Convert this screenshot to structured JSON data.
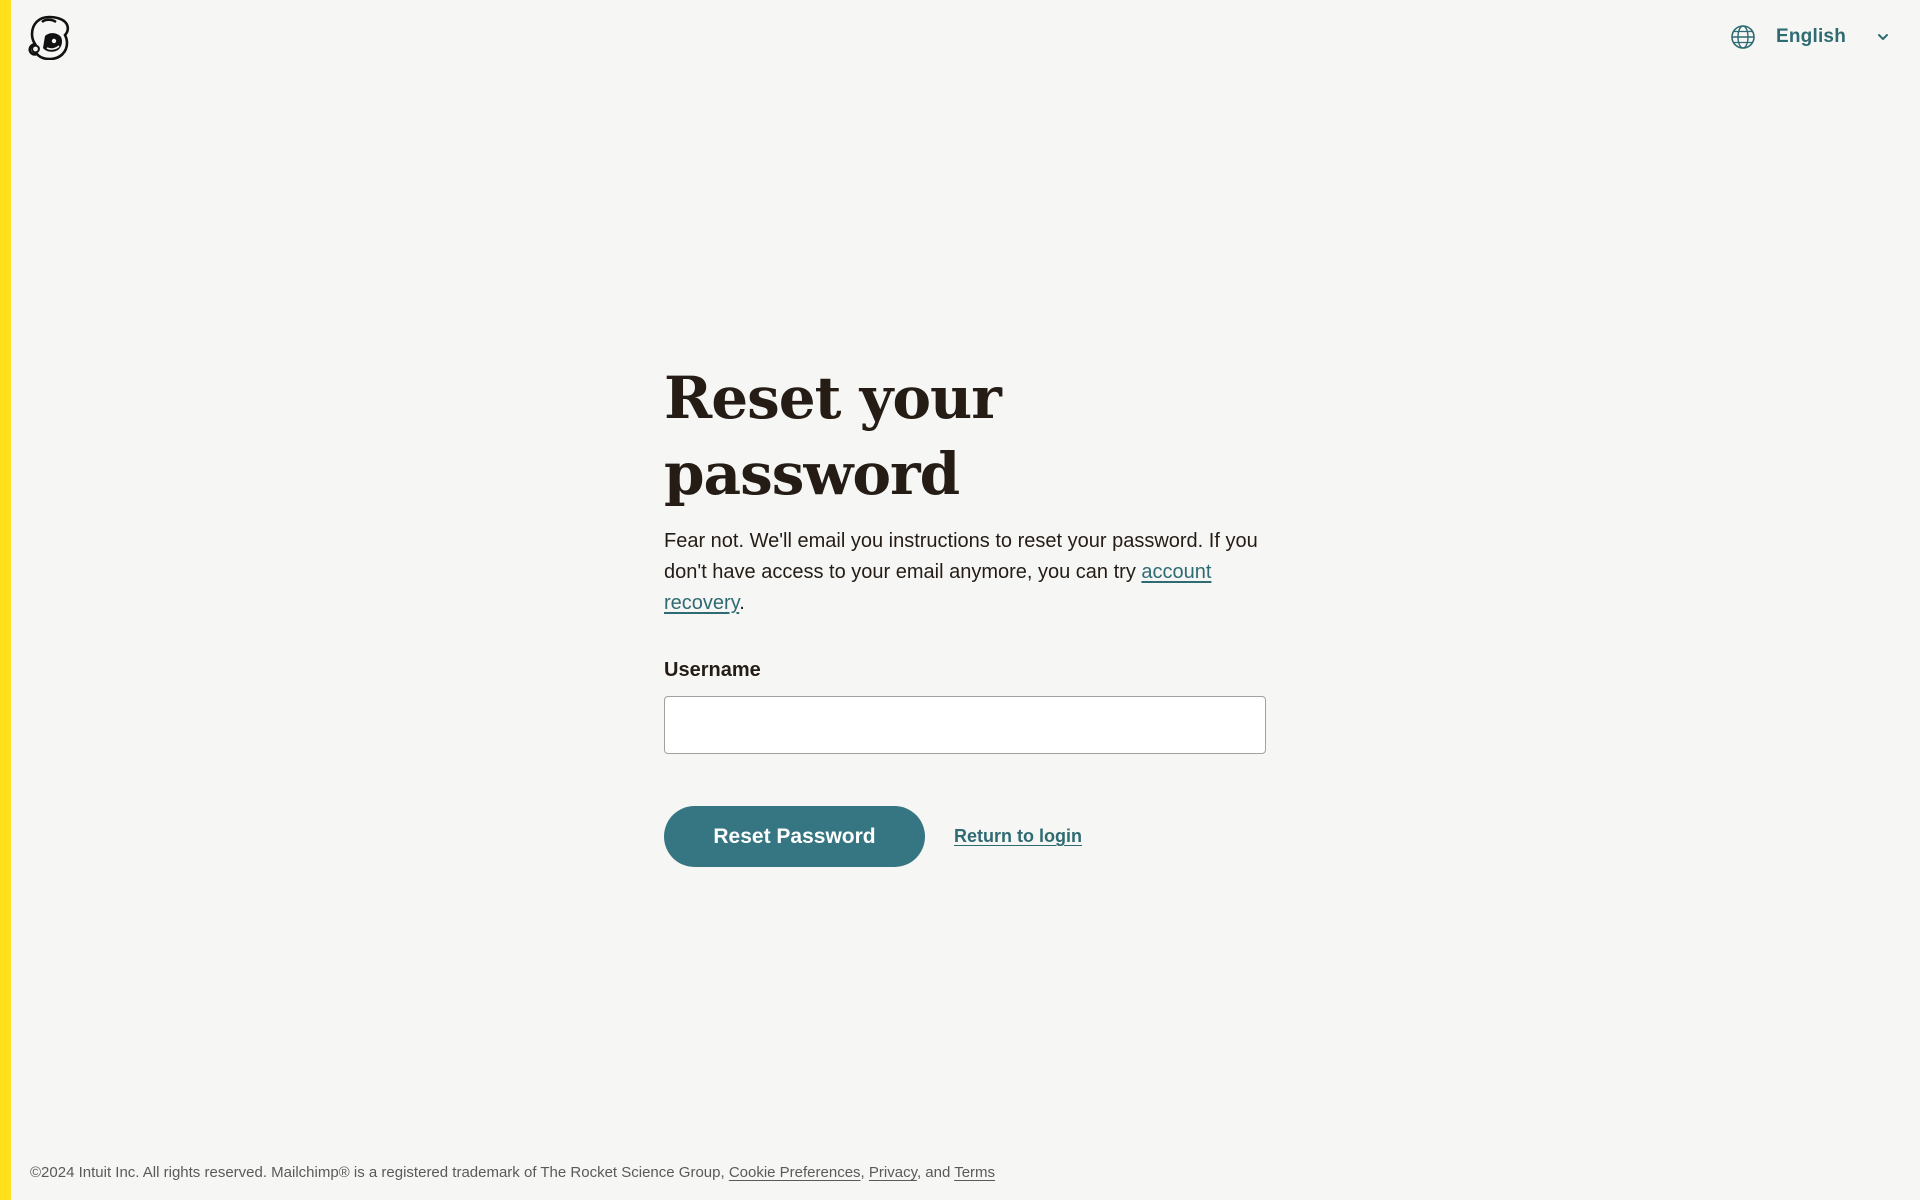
{
  "header": {
    "logo_icon": "mailchimp-freddie-logo",
    "language": {
      "icon": "globe-icon",
      "selected": "English",
      "chevron_icon": "chevron-down-icon"
    }
  },
  "main": {
    "title": "Reset your password",
    "description_text": "Fear not. We'll email you instructions to reset your password. If you don't have access to your email anymore, you can try ",
    "recovery_link": "account recovery",
    "description_end": ".",
    "username_label": "Username",
    "username_value": "",
    "username_placeholder": "",
    "reset_button": "Reset Password",
    "return_link": "Return to login"
  },
  "footer": {
    "text": "©2024 Intuit Inc. All rights reserved. Mailchimp® is a registered trademark of The Rocket Science Group, ",
    "cookie_link": "Cookie Preferences",
    "sep1": ", ",
    "privacy_link": "Privacy",
    "sep2": ", and ",
    "terms_link": "Terms"
  },
  "colors": {
    "accent_bar": "#ffe01b",
    "primary": "#357682",
    "link": "#2f6b73",
    "background": "#f6f6f4",
    "text": "#241c15"
  }
}
